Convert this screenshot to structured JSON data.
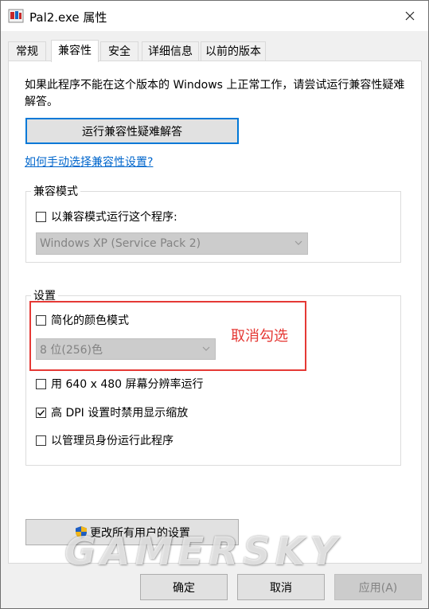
{
  "window": {
    "title": "Pal2.exe 属性"
  },
  "tabs": [
    {
      "label": "常规"
    },
    {
      "label": "兼容性"
    },
    {
      "label": "安全"
    },
    {
      "label": "详细信息"
    },
    {
      "label": "以前的版本"
    }
  ],
  "active_tab": "兼容性",
  "compat": {
    "description": "如果此程序不能在这个版本的 Windows 上正常工作，请尝试运行兼容性疑难解答。",
    "troubleshoot_button": "运行兼容性疑难解答",
    "help_link": "如何手动选择兼容性设置?",
    "mode_group": {
      "title": "兼容模式",
      "checkbox_label": "以兼容模式运行这个程序:",
      "checked": false,
      "select_value": "Windows XP (Service Pack 2)"
    },
    "settings_group": {
      "title": "设置",
      "items": [
        {
          "label": "简化的颜色模式",
          "checked": false
        },
        {
          "label": "用 640 x 480 屏幕分辨率运行",
          "checked": false
        },
        {
          "label": "高 DPI 设置时禁用显示缩放",
          "checked": true
        },
        {
          "label": "以管理员身份运行此程序",
          "checked": false
        }
      ],
      "color_select_value": "8 位(256)色"
    },
    "all_users_button": "更改所有用户的设置"
  },
  "annotation": {
    "text": "取消勾选",
    "color": "#e53935"
  },
  "footer": {
    "ok": "确定",
    "cancel": "取消",
    "apply": "应用(A)"
  },
  "watermark": "GAMERSKY",
  "colors": {
    "accent": "#0078d7",
    "link": "#0066cc",
    "annotation": "#e53935"
  }
}
